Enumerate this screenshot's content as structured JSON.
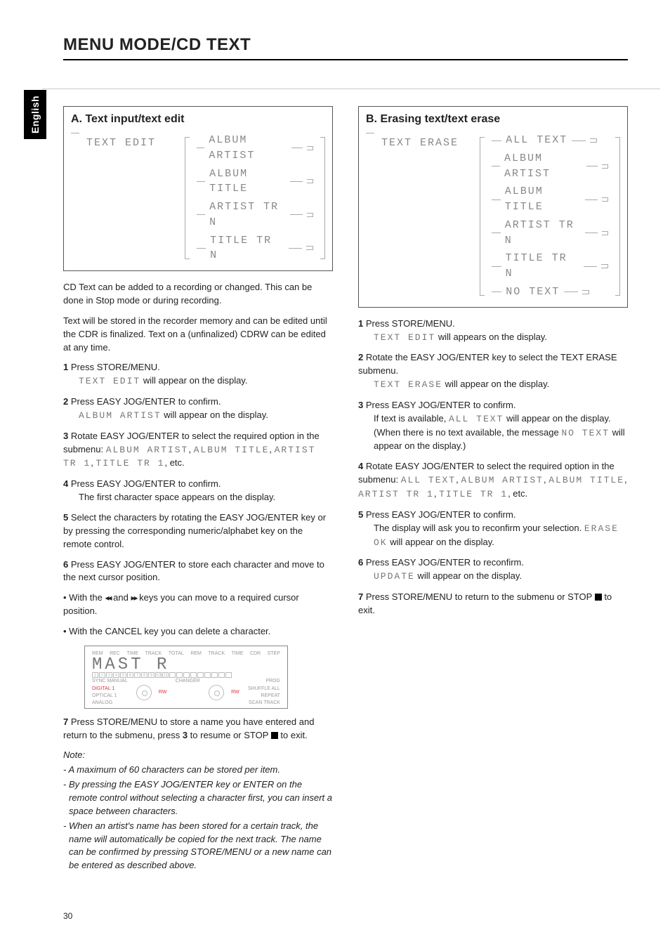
{
  "language_tab": "English",
  "page_title": "MENU MODE/CD TEXT",
  "page_number": "30",
  "colA": {
    "panel_title": "A. Text input/text edit",
    "diagram_left": "TEXT EDIT",
    "diagram_items": [
      "ALBUM ARTIST",
      "ALBUM TITLE",
      "ARTIST TR N",
      "TITLE TR N"
    ],
    "intro1": "CD Text can be added to a recording or changed. This can be done in Stop mode or during recording.",
    "intro2": "Text will be stored in the recorder memory and can be edited until the CDR is finalized. Text on a (unfinalized) CDRW can be edited at any time.",
    "s1_n": "1",
    "s1_t": " Press STORE/MENU.",
    "s1_sub_lcd": "TEXT EDIT",
    "s1_sub_rest": " will appear on the display.",
    "s2_n": "2",
    "s2_t": " Press EASY JOG/ENTER to confirm.",
    "s2_sub_lcd": "ALBUM ARTIST",
    "s2_sub_rest": " will appear on the display.",
    "s3_n": "3",
    "s3_t": " Rotate EASY JOG/ENTER to select the required option in the submenu: ",
    "s3_lcd1": "ALBUM ARTIST",
    "s3_c1": ", ",
    "s3_lcd2": "ALBUM TITLE",
    "s3_c2": ", ",
    "s3_lcd3": "ARTIST TR 1",
    "s3_c3": ", ",
    "s3_lcd4": "TITLE TR 1",
    "s3_end": ", etc.",
    "s4_n": "4",
    "s4_t": " Press EASY JOG/ENTER to confirm.",
    "s4_sub": "The first character space appears on the display.",
    "s5_n": "5",
    "s5_t": " Select the characters by rotating the EASY JOG/ENTER key or by pressing the corresponding numeric/alphabet key on the remote control.",
    "s6_n": "6",
    "s6_t": " Press EASY JOG/ENTER to store each character and move to the next cursor position.",
    "bullet1_a": "• With the ",
    "bullet1_rw": "◂◂",
    "bullet1_mid": " and ",
    "bullet1_ff": "▸▸",
    "bullet1_b": " keys you can move to a required cursor position.",
    "bullet2": "• With the CANCEL key you can delete a character.",
    "display_big": "MAST R",
    "display_labels_top": [
      "REM",
      "REC",
      "TIME",
      "TRACK",
      "",
      "TOTAL",
      "REM",
      "TRACK",
      "TIME",
      "",
      "CDR",
      "STEP"
    ],
    "display_labels_left": [
      "SYNC",
      "MANUAL",
      "DIGITAL 1",
      "OPTICAL 1",
      "ANALOG"
    ],
    "display_labels_right": [
      "PROG",
      "SHUFFLE",
      "ALL",
      "REPEAT",
      "SCAN",
      "TRACK"
    ],
    "display_rw": "RW",
    "display_changer": "CHANGER",
    "s7_n": "7",
    "s7_t_a": " Press STORE/MENU to store a name you have entered and return to the submenu, press ",
    "s7_bold": "3",
    "s7_t_b": " to resume or STOP ",
    "s7_t_c": " to exit.",
    "note_hd": "Note:",
    "note1": "- A maximum of 60 characters can be stored per item.",
    "note2": "- By pressing the EASY JOG/ENTER key or ENTER on the remote control without selecting a character first, you can insert a space between characters.",
    "note3": "- When an artist's name has been stored for a certain track, the name will automatically be copied for the next track. The name can be confirmed by pressing STORE/MENU or a new name can be entered as described above."
  },
  "colB": {
    "panel_title": "B. Erasing text/text erase",
    "diagram_left": "TEXT ERASE",
    "diagram_items": [
      "ALL TEXT",
      "ALBUM ARTIST",
      "ALBUM TITLE",
      "ARTIST TR N",
      "TITLE TR N",
      "NO TEXT"
    ],
    "s1_n": "1",
    "s1_t": " Press STORE/MENU.",
    "s1_sub_lcd": "TEXT EDIT",
    "s1_sub_rest": " will appears on the display.",
    "s2_n": "2",
    "s2_t": " Rotate the EASY JOG/ENTER key to select the TEXT ERASE submenu.",
    "s2_sub_lcd": "TEXT ERASE",
    "s2_sub_rest": " will appear on the display.",
    "s3_n": "3",
    "s3_t": " Press EASY JOG/ENTER to confirm.",
    "s3_sub_a": "If text is available, ",
    "s3_sub_lcd1": "ALL TEXT",
    "s3_sub_b": " will appear on the display. (When there is no text available, the message ",
    "s3_sub_lcd2": "NO TEXT",
    "s3_sub_c": " will appear on the display.)",
    "s4_n": "4",
    "s4_t": " Rotate EASY JOG/ENTER to select the required option in the submenu: ",
    "s4_lcd1": "ALL TEXT",
    "s4_c1": ", ",
    "s4_lcd2": "ALBUM ARTIST",
    "s4_c2": ", ",
    "s4_lcd3": "ALBUM TITLE",
    "s4_c3": ", ",
    "s4_lcd4": "ARTIST TR 1",
    "s4_c4": ", ",
    "s4_lcd5": "TITLE TR 1",
    "s4_end": ", etc.",
    "s5_n": "5",
    "s5_t": " Press EASY JOG/ENTER to confirm.",
    "s5_sub_a": "The display will ask you to reconfirm your selection. ",
    "s5_sub_lcd": "ERASE OK",
    "s5_sub_b": " will appear on the display.",
    "s6_n": "6",
    "s6_t": " Press EASY JOG/ENTER to reconfirm.",
    "s6_sub_lcd": "UPDATE",
    "s6_sub_rest": " will appear on the display.",
    "s7_n": "7",
    "s7_t_a": " Press STORE/MENU to return to the submenu or STOP ",
    "s7_t_b": " to exit."
  }
}
